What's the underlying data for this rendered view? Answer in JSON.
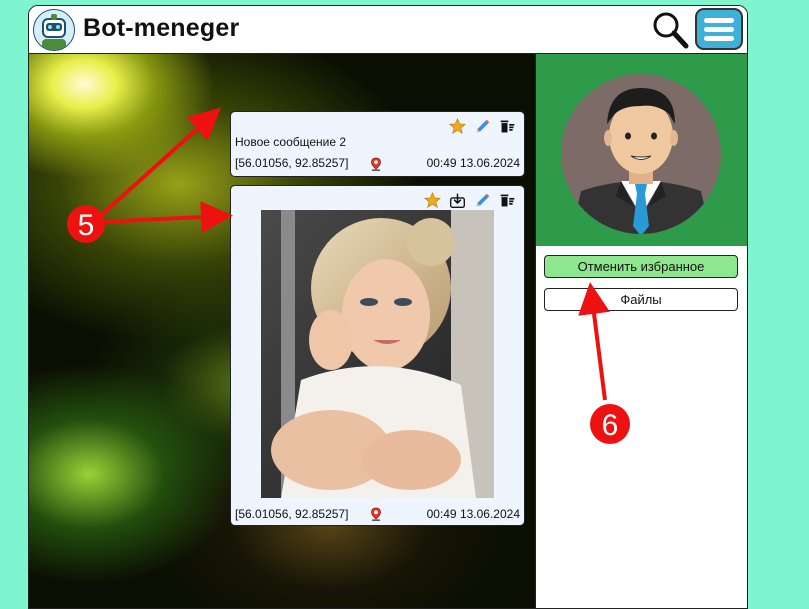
{
  "header": {
    "title": "Bot-meneger",
    "logo_icon": "robot-avatar-icon",
    "search_icon": "search-icon",
    "menu_icon": "menu-icon"
  },
  "messages": [
    {
      "text": "Новое сообщение 2",
      "coords": "[56.01056, 92.85257]",
      "time": "00:49 13.06.2024",
      "icons": [
        "star-icon",
        "pencil-icon",
        "trash-icon"
      ]
    },
    {
      "coords": "[56.01056, 92.85257]",
      "time": "00:49 13.06.2024",
      "icons": [
        "star-icon",
        "download-icon",
        "pencil-icon",
        "trash-icon"
      ],
      "photo": "woman-portrait-photo"
    }
  ],
  "sidebar": {
    "avatar_icon": "businessman-avatar-icon",
    "unfavorite_label": "Отменить избранное",
    "files_label": "Файлы"
  },
  "annotations": {
    "arrow_5_label": "5",
    "arrow_6_label": "6"
  },
  "colors": {
    "page_bg": "#7ef5cf",
    "menu_bg": "#3fb0d8",
    "avatar_bg": "#2e9b4a",
    "fav_button_bg": "#8ee68f",
    "card_bg": "#eef5ff",
    "annotation_red": "#ee1111"
  }
}
